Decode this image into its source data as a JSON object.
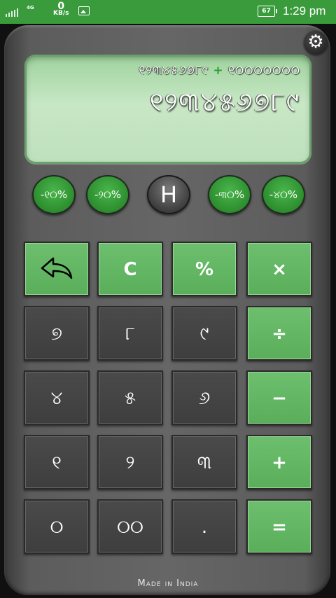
{
  "status_bar": {
    "network": "4G",
    "speed_value": "0",
    "speed_unit": "KB/s",
    "battery": "67",
    "time": "1:29 pm"
  },
  "display": {
    "expression_left": "୧୨୩୪୫୬୭୮୯",
    "expression_op": "+",
    "expression_right": "୧୦୦୦୦୦୦୦",
    "result": "୧୨୩୪୫୬୭୮୯"
  },
  "round_buttons": [
    "-୧୦%",
    "-୨୦%",
    "H",
    "-୩୦%",
    "-୪୦%"
  ],
  "keys": {
    "back": "↶",
    "clear": "C",
    "percent": "%",
    "multiply": "×",
    "n7": "୭",
    "n8": "୮",
    "n9": "୯",
    "divide": "÷",
    "n4": "୪",
    "n5": "୫",
    "n6": "୬",
    "minus": "−",
    "n1": "୧",
    "n2": "୨",
    "n3": "୩",
    "plus": "+",
    "n0": "୦",
    "n00": "୦୦",
    "dot": ".",
    "equals": "="
  },
  "footer": "Made in India",
  "colors": {
    "accent": "#3a9b3c",
    "key_green": "#5aae5a",
    "display": "#bfe0bd"
  },
  "icons": {
    "settings": "gear-icon",
    "back": "undo-arrow-icon"
  }
}
